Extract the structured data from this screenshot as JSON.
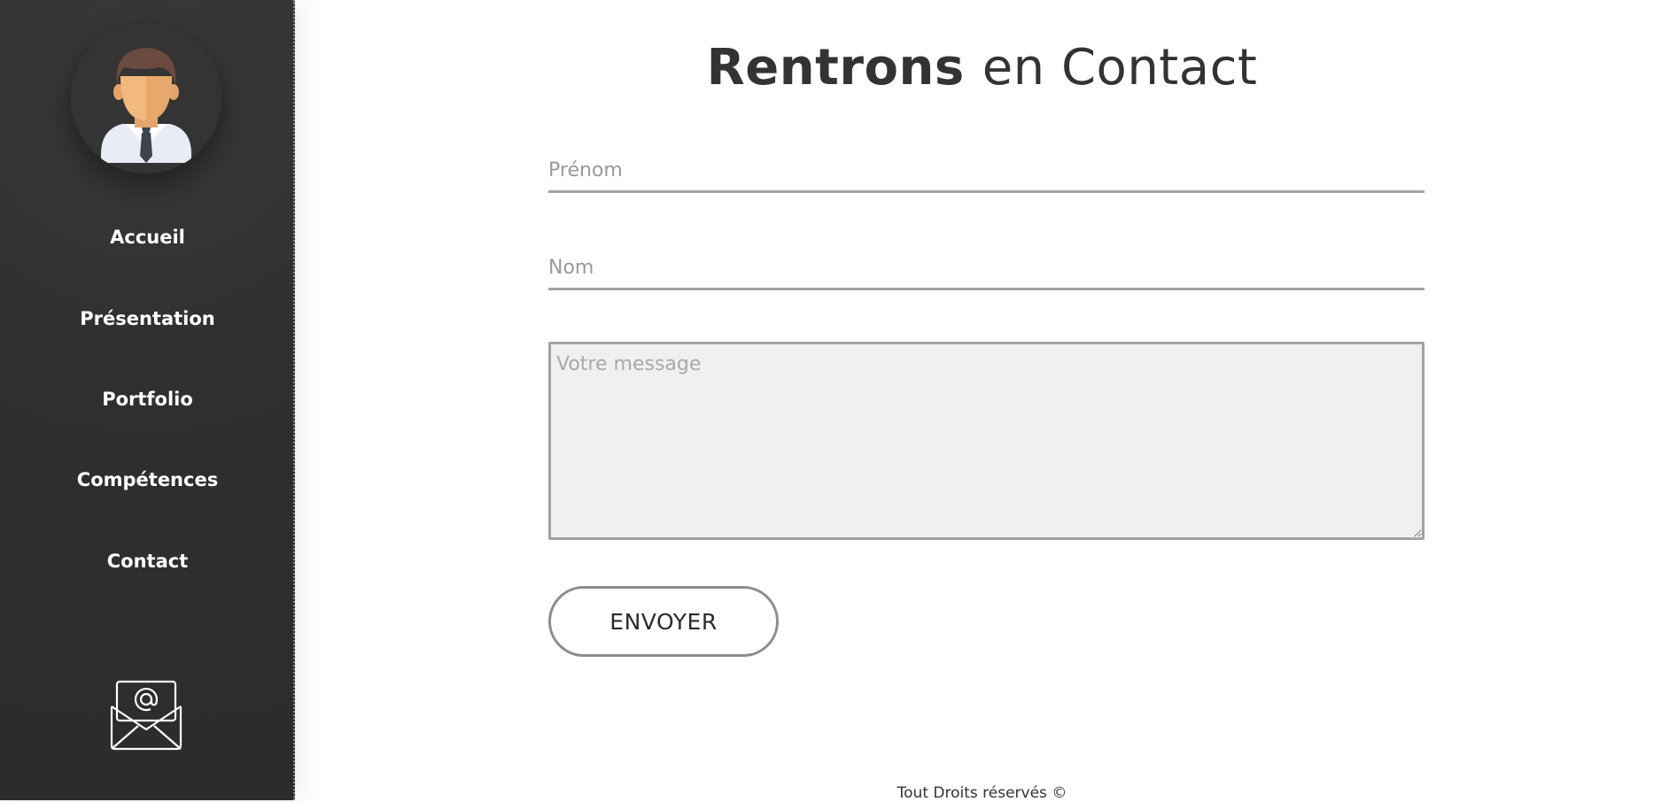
{
  "sidebar": {
    "avatar_icon": "businessman-avatar-icon",
    "items": [
      {
        "label": "Accueil"
      },
      {
        "label": "Présentation"
      },
      {
        "label": "Portfolio"
      },
      {
        "label": "Compétences"
      },
      {
        "label": "Contact"
      }
    ],
    "mail_icon": "envelope-at-icon"
  },
  "main": {
    "title_strong": "Rentrons",
    "title_light": "en Contact",
    "form": {
      "first_name_placeholder": "Prénom",
      "last_name_placeholder": "Nom",
      "message_placeholder": "Votre message",
      "submit_label": "ENVOYER"
    },
    "footer": "Tout Droits réservés ©"
  },
  "colors": {
    "sidebar_bg": "#2f2f2f",
    "text_dark": "#333333",
    "field_border": "#a3a3a3",
    "textarea_bg": "#f0f0f0"
  }
}
